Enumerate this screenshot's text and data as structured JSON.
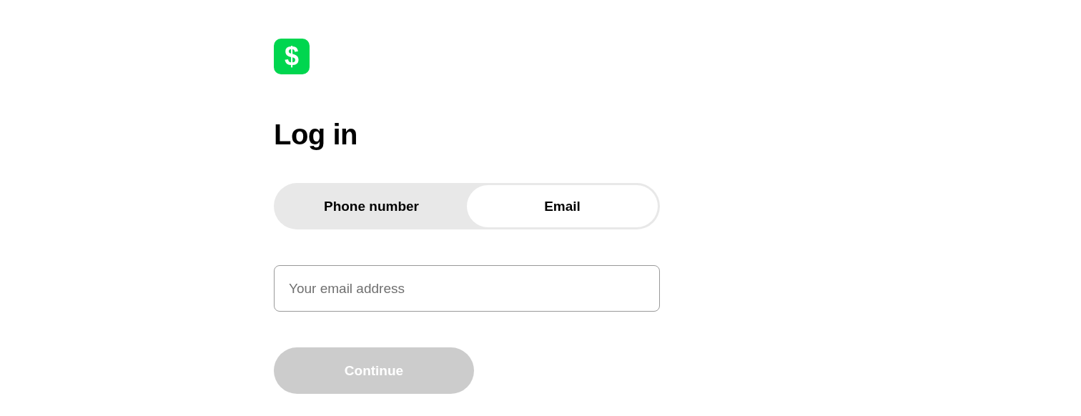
{
  "logo": {
    "symbol": "$"
  },
  "heading": "Log in",
  "tabs": [
    {
      "label": "Phone number",
      "selected": false
    },
    {
      "label": "Email",
      "selected": true
    }
  ],
  "email_field": {
    "placeholder": "Your email address"
  },
  "continue_button": {
    "label": "Continue",
    "disabled": true
  }
}
